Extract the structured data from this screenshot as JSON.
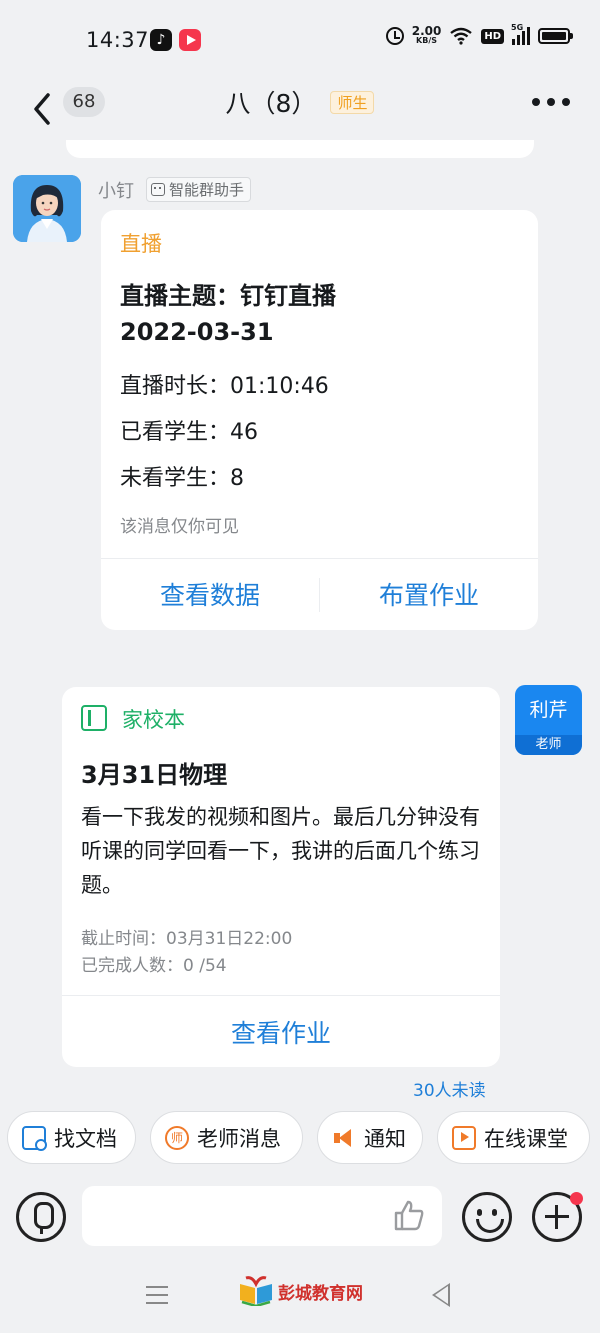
{
  "status_bar": {
    "time": "14:37",
    "net_speed_value": "2.00",
    "net_speed_unit": "KB/S",
    "hd_label": "HD",
    "signal_label": "5G"
  },
  "header": {
    "unread_count": "68",
    "title": "八（8）",
    "role_tag": "师生"
  },
  "bot_message": {
    "sender_name": "小钉",
    "assistant_tag": "智能群助手",
    "card_type": "直播",
    "topic_line1": "直播主题：钉钉直播",
    "topic_line2": "2022-03-31",
    "duration": "直播时长：01:10:46",
    "watched": "已看学生：46",
    "not_watched": "未看学生：8",
    "visibility_note": "该消息仅你可见",
    "action_view_data": "查看数据",
    "action_assign_homework": "布置作业"
  },
  "teacher_message": {
    "avatar_name": "利芹",
    "avatar_role": "老师",
    "card_type": "家校本",
    "title": "3月31日物理",
    "body": "看一下我发的视频和图片。最后几分钟没有听课的同学回看一下，我讲的后面几个练习题。",
    "deadline": "截止时间：03月31日22:00",
    "completed": "已完成人数：0 /54",
    "action_view_homework": "查看作业",
    "read_status": "30人未读"
  },
  "quick_actions": [
    {
      "label": "找文档",
      "icon": "doc-search-icon"
    },
    {
      "label": "老师消息",
      "icon": "teacher-icon"
    },
    {
      "label": "通知",
      "icon": "megaphone-icon"
    },
    {
      "label": "在线课堂",
      "icon": "online-class-icon"
    }
  ],
  "input_bar": {
    "placeholder": ""
  },
  "watermark": {
    "text": "彭城教育网"
  },
  "colors": {
    "accent_blue": "#1f7fd8",
    "live_orange": "#f0a030",
    "homework_green": "#1eb067",
    "background": "#f0f1f3"
  }
}
